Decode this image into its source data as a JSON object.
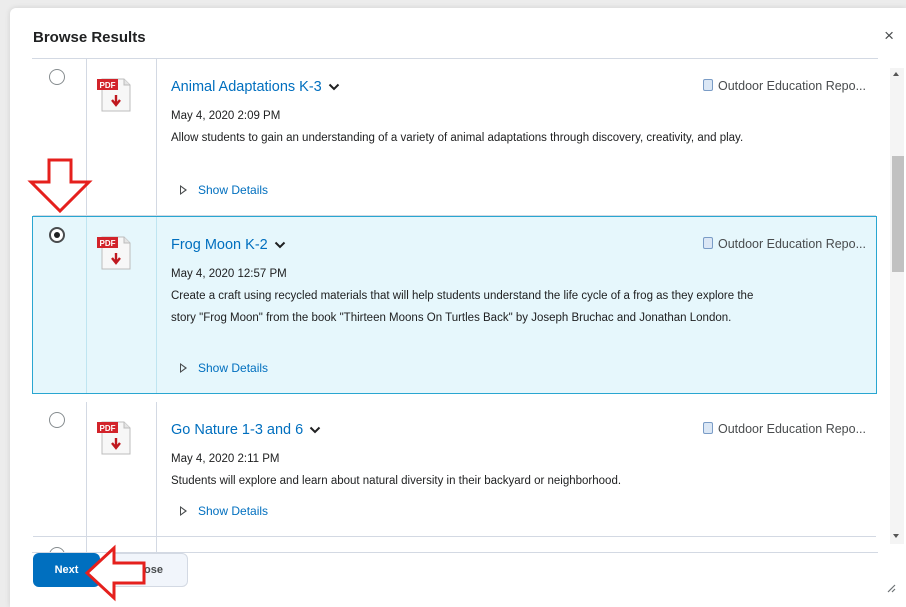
{
  "dialog": {
    "title": "Browse Results",
    "close_icon": "×"
  },
  "results": [
    {
      "title": "Animal Adaptations K-3",
      "repository": "Outdoor Education Repo...",
      "date": "May 4, 2020 2:09 PM",
      "description": "Allow students to gain an understanding of a variety of animal adaptations through discovery, creativity, and play.",
      "show_details": "Show Details",
      "selected": false
    },
    {
      "title": "Frog Moon K-2",
      "repository": "Outdoor Education Repo...",
      "date": "May 4, 2020 12:57 PM",
      "description": "Create a craft using recycled materials that will help students understand the life cycle of a frog as they explore the story \"Frog Moon\" from the book \"Thirteen Moons On Turtles Back\" by Joseph Bruchac and Jonathan London.",
      "show_details": "Show Details",
      "selected": true
    },
    {
      "title": "Go Nature 1-3 and 6",
      "repository": "Outdoor Education Repo...",
      "date": "May 4, 2020 2:11 PM",
      "description": "Students will explore and learn about natural diversity in their backyard or neighborhood.",
      "show_details": "Show Details",
      "selected": false
    }
  ],
  "file_icon_label": "PDF",
  "footer": {
    "next_label": "Next",
    "close_label": "Close"
  },
  "colors": {
    "accent": "#006fbf",
    "selected_bg": "#e6f7fc",
    "annotation_arrow": "#e5201d"
  }
}
